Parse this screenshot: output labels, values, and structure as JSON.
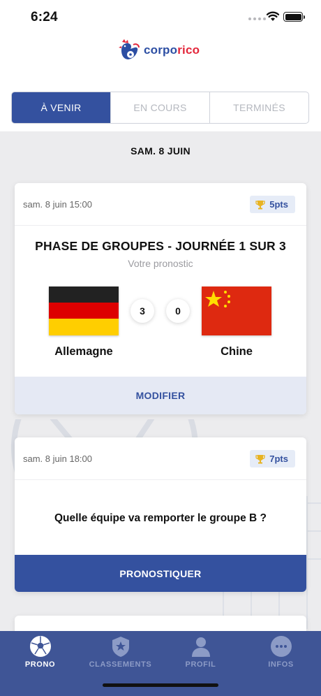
{
  "status_bar": {
    "time": "6:24"
  },
  "brand": {
    "part1": "corpo",
    "part2": "rico"
  },
  "tabs": [
    {
      "label": "À VENIR",
      "active": true
    },
    {
      "label": "EN COURS",
      "active": false
    },
    {
      "label": "TERMINÉS",
      "active": false
    }
  ],
  "date_header": "SAM. 8 JUIN",
  "cards": [
    {
      "date": "sam. 8 juin 15:00",
      "points": "5pts",
      "phase": "PHASE DE GROUPES - JOURNÉE 1 SUR 3",
      "subtitle": "Votre pronostic",
      "team_a": "Allemagne",
      "team_b": "Chine",
      "score_a": "3",
      "score_b": "0",
      "action": "MODIFIER"
    },
    {
      "date": "sam. 8 juin 18:00",
      "points": "7pts",
      "question": "Quelle équipe va remporter le groupe B ?",
      "action": "PRONOSTIQUER"
    }
  ],
  "tabbar": [
    {
      "label": "PRONO",
      "icon": "soccer-ball-icon",
      "active": true
    },
    {
      "label": "CLASSEMENTS",
      "icon": "star-badge-icon",
      "active": false
    },
    {
      "label": "PROFIL",
      "icon": "user-icon",
      "active": false
    },
    {
      "label": "INFOS",
      "icon": "chat-bubble-icon",
      "active": false
    }
  ],
  "colors": {
    "primary": "#34519f",
    "tabbar": "#3f5596",
    "accent_red": "#e3263a",
    "light_blue": "#e5e9f4"
  }
}
